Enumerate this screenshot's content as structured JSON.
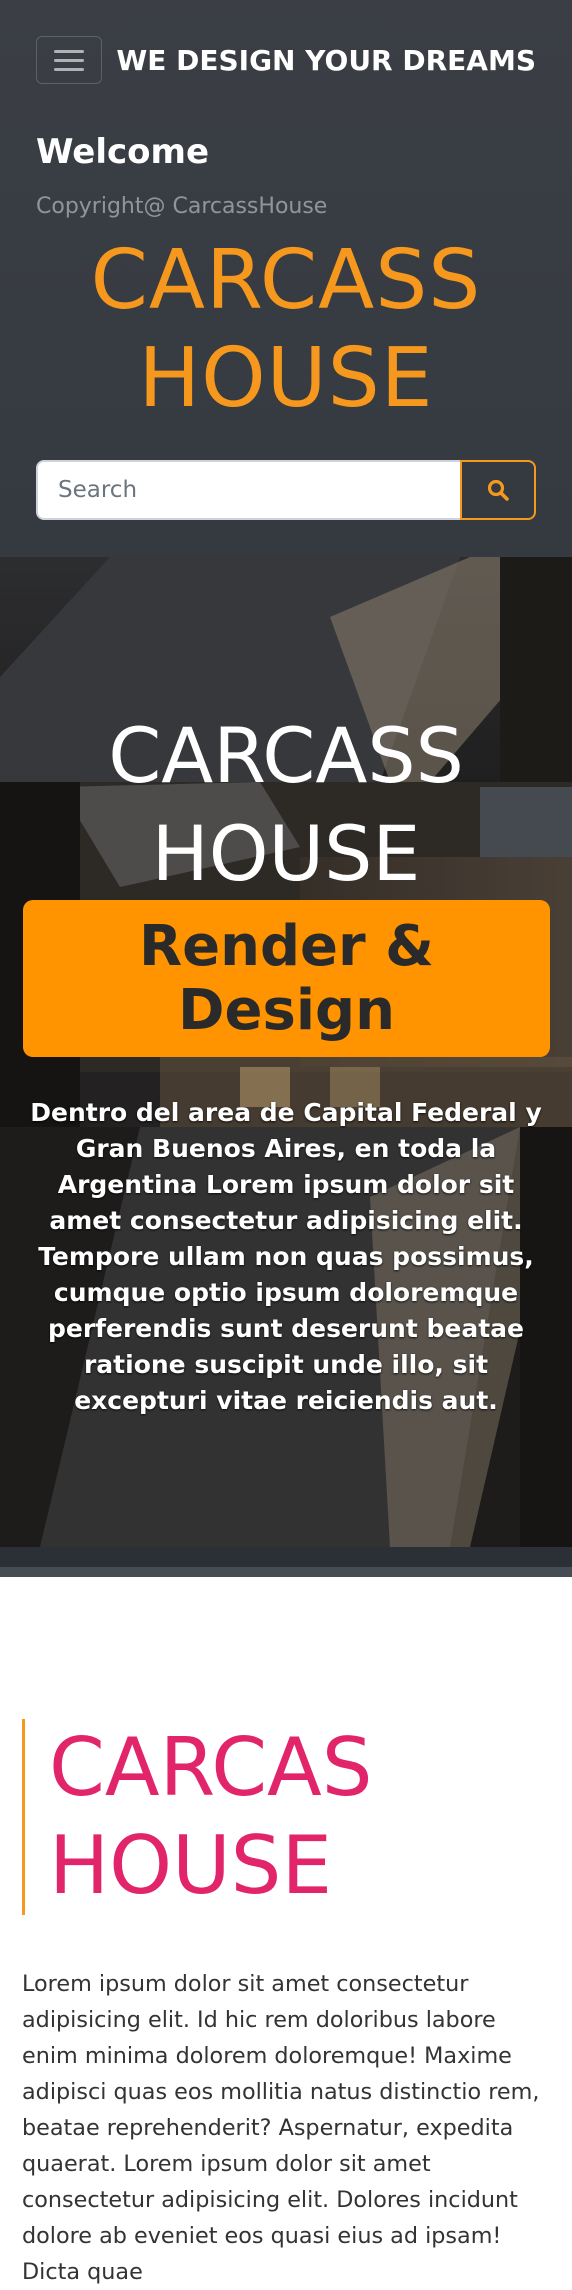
{
  "header": {
    "brand": "WE DESIGN YOUR DREAMS",
    "welcome": "Welcome",
    "copyright": "Copyright@ CarcassHouse",
    "logo_line1": "CARCASS",
    "logo_line2": "HOUSE",
    "search_placeholder": "Search",
    "menu_icon": "hamburger-menu-icon",
    "search_icon": "search-icon"
  },
  "hero": {
    "title_line1": "CARCASS",
    "title_line2": "HOUSE",
    "badge_line1": "Render &",
    "badge_line2": "Design",
    "description": "Dentro del area de Capital Federal y Gran Buenos Aires, en toda la Argentina Lorem ipsum dolor sit amet consectetur adipisicing elit. Tempore ullam non quas possimus, cumque optio ipsum doloremque perferendis sunt deserunt beatae ratione suscipit unde illo, sit excepturi vitae reiciendis aut."
  },
  "about": {
    "heading_line1": "CARCAS",
    "heading_line2": "HOUSE",
    "body": "Lorem ipsum dolor sit amet consectetur adipisicing elit. Id hic rem doloribus labore enim minima dolorem doloremque! Maxime adipisci quas eos mollitia natus distinctio rem, beatae reprehenderit? Aspernatur, expedita quaerat. Lorem ipsum dolor sit amet consectetur adipisicing elit. Dolores incidunt dolore ab eveniet eos quasi eius ad ipsam! Dicta quae"
  },
  "colors": {
    "accent_orange": "#f6981e",
    "badge_orange": "#ff9300",
    "heading_pink": "#e2256a",
    "header_dark": "#343a40"
  }
}
